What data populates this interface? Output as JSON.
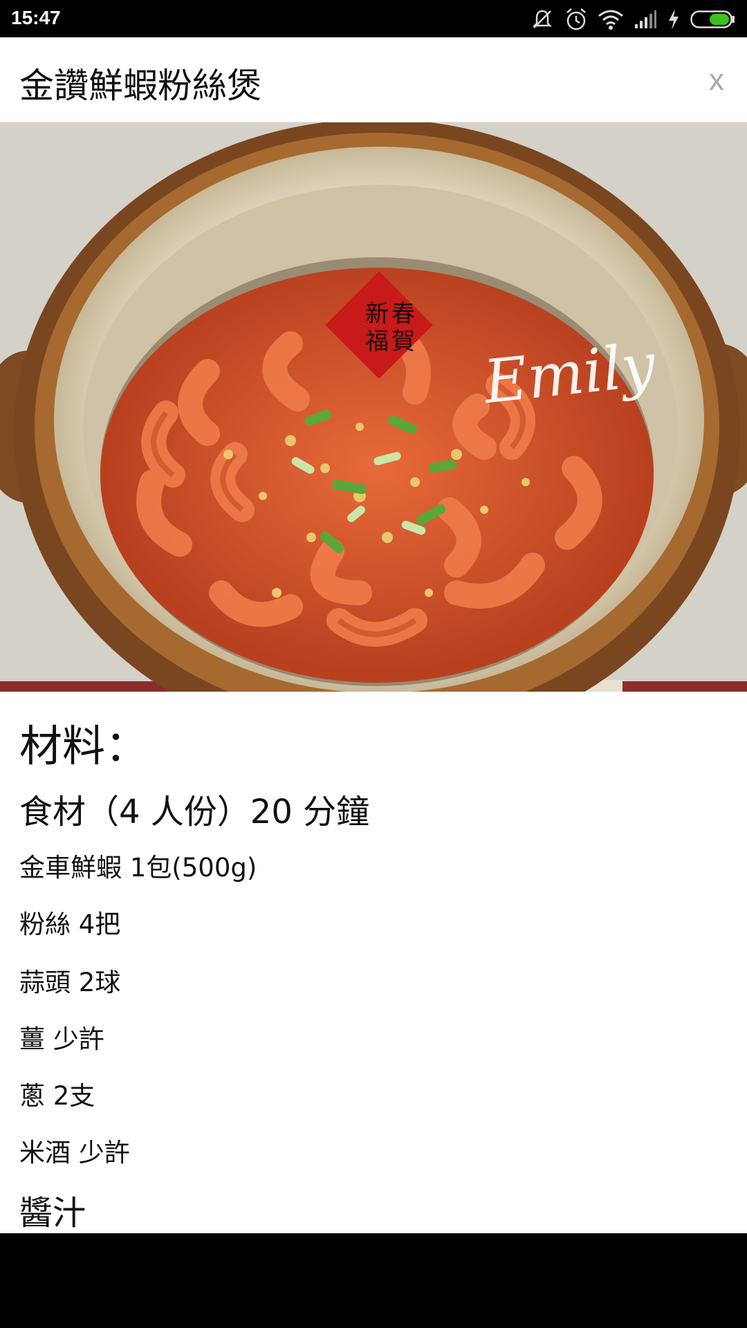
{
  "status_bar": {
    "time": "15:47",
    "icons": [
      "mute-vibrate-icon",
      "alarm-icon",
      "wifi-icon",
      "signal-icon",
      "charging-icon",
      "battery-icon"
    ],
    "battery_color": "#3cc21e"
  },
  "header": {
    "title": "金讚鮮蝦粉絲煲",
    "close_label": "x"
  },
  "hero": {
    "stamp_text": [
      "新",
      "春",
      "福",
      "賀"
    ],
    "watermark": "Emily"
  },
  "recipe": {
    "ingredients_heading": "材料：",
    "portion_line": "食材（4 人份）20 分鐘",
    "ingredients": [
      "金車鮮蝦 1包(500g)",
      "粉絲 4把",
      "蒜頭 2球",
      "薑 少許",
      "蔥 2支",
      "米酒 少許"
    ],
    "sauce_heading": "醬汁"
  }
}
